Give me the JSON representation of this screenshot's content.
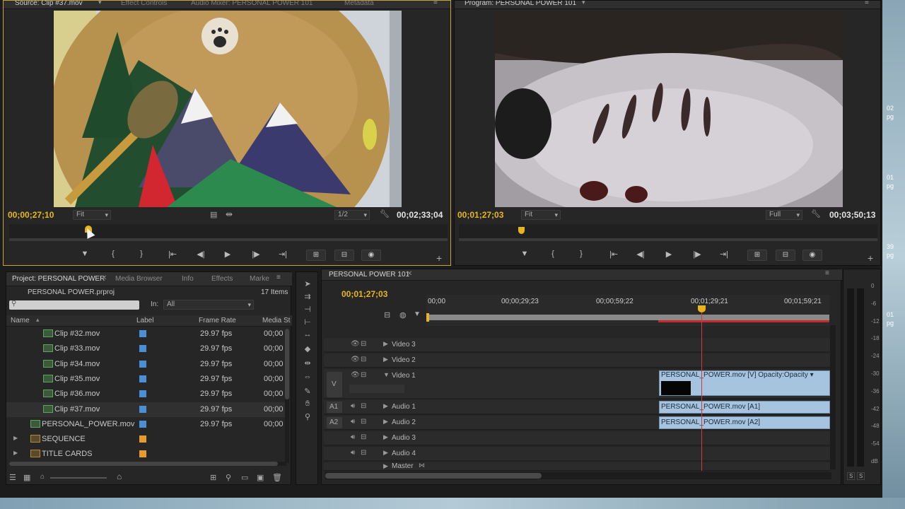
{
  "source_monitor": {
    "tabs": [
      "Source: Clip #37.mov",
      "Effect Controls",
      "Audio Mixer: PERSONAL POWER 101",
      "Metadata"
    ],
    "timecode_in": "00;00;27;10",
    "zoom": "Fit",
    "resolution": "1/2",
    "duration": "00;02;33;04",
    "playhead_fraction": 0.18
  },
  "program_monitor": {
    "tab": "Program: PERSONAL POWER 101",
    "timecode": "00;01;27;03",
    "zoom": "Fit",
    "resolution": "Full",
    "duration": "00;03;50;13",
    "playhead_fraction": 0.148
  },
  "project": {
    "tabs": [
      "Project: PERSONAL POWER",
      "Media Browser",
      "Info",
      "Effects",
      "Marke"
    ],
    "file": "PERSONAL POWER.prproj",
    "item_count": "17 Items",
    "in_label": "In:",
    "in_value": "All",
    "columns": [
      "Name",
      "Label",
      "Frame Rate",
      "Media St"
    ],
    "rows": [
      {
        "name": "Clip #32.mov",
        "color": "#4a8fd6",
        "fps": "29.97 fps",
        "media": "00;00"
      },
      {
        "name": "Clip #33.mov",
        "color": "#4a8fd6",
        "fps": "29.97 fps",
        "media": "00;00"
      },
      {
        "name": "Clip #34.mov",
        "color": "#4a8fd6",
        "fps": "29.97 fps",
        "media": "00;00"
      },
      {
        "name": "Clip #35.mov",
        "color": "#4a8fd6",
        "fps": "29.97 fps",
        "media": "00;00"
      },
      {
        "name": "Clip #36.mov",
        "color": "#4a8fd6",
        "fps": "29.97 fps",
        "media": "00;00"
      },
      {
        "name": "Clip #37.mov",
        "color": "#4a8fd6",
        "fps": "29.97 fps",
        "media": "00;00"
      },
      {
        "name": "PERSONAL_POWER.mov",
        "color": "#4a8fd6",
        "fps": "29.97 fps",
        "media": "00;00"
      },
      {
        "name": "SEQUENCE",
        "color": "#e89a2c",
        "fps": "",
        "media": ""
      },
      {
        "name": "TITLE CARDS",
        "color": "#e89a2c",
        "fps": "",
        "media": ""
      }
    ]
  },
  "timeline": {
    "tab": "PERSONAL POWER 101",
    "timecode": "00;01;27;03",
    "ruler": [
      "00;00",
      "00;00;29;23",
      "00;00;59;22",
      "00;01;29;21",
      "00;01;59;21"
    ],
    "tracks": {
      "video3": "Video 3",
      "video2": "Video 2",
      "video1": "Video 1",
      "audio1": "Audio 1",
      "audio2": "Audio 2",
      "audio3": "Audio 3",
      "audio4": "Audio 4",
      "master": "Master"
    },
    "patch": {
      "v": "V",
      "a1": "A1",
      "a2": "A2"
    },
    "clips": {
      "video": "PERSONAL_POWER.mov [V]  Opacity:Opacity ▾",
      "audio1": "PERSONAL_POWER.mov [A1]",
      "audio2": "PERSONAL_POWER.mov [A2]"
    }
  },
  "meter": {
    "db_labels": [
      "0",
      "-6",
      "-12",
      "-18",
      "-24",
      "-30",
      "-36",
      "-42",
      "-48",
      "-54",
      "dB"
    ],
    "solo": [
      "S",
      "S"
    ]
  },
  "edge_labels": [
    "02",
    "pg",
    "01",
    "pg",
    "39",
    "pg",
    "01",
    "pg"
  ]
}
